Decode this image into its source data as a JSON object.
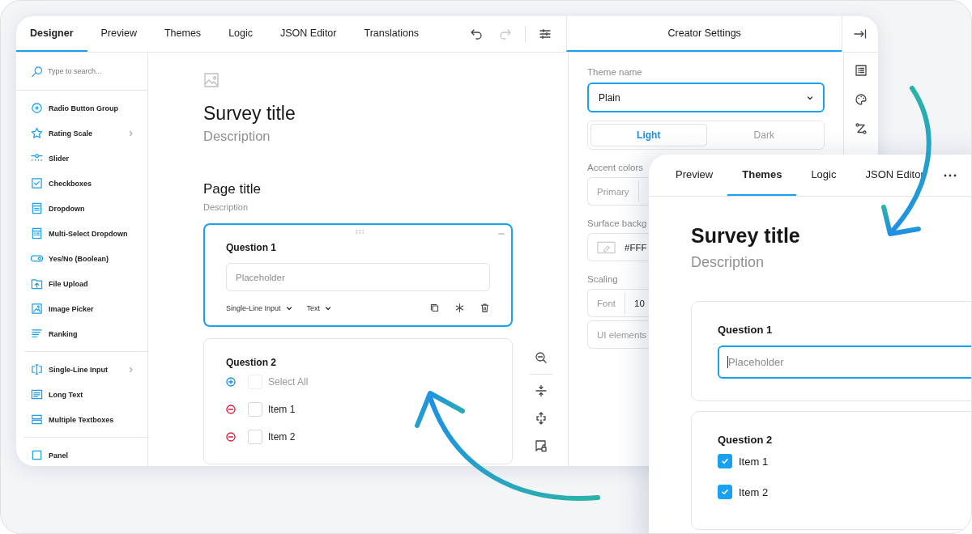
{
  "designer_window": {
    "tabs": [
      {
        "label": "Designer",
        "selected": true
      },
      {
        "label": "Preview",
        "selected": false
      },
      {
        "label": "Themes",
        "selected": false
      },
      {
        "label": "Logic",
        "selected": false
      },
      {
        "label": "JSON Editor",
        "selected": false
      },
      {
        "label": "Translations",
        "selected": false
      }
    ],
    "search": {
      "placeholder": "Type to search..."
    },
    "toolbox_groups": [
      {
        "items": [
          {
            "label": "Radio Button Group",
            "expandable": false
          },
          {
            "label": "Rating Scale",
            "expandable": true
          },
          {
            "label": "Slider",
            "expandable": false
          },
          {
            "label": "Checkboxes",
            "expandable": false
          },
          {
            "label": "Dropdown",
            "expandable": false
          },
          {
            "label": "Multi-Select Dropdown",
            "expandable": false
          },
          {
            "label": "Yes/No (Boolean)",
            "expandable": false
          },
          {
            "label": "File Upload",
            "expandable": false
          },
          {
            "label": "Image Picker",
            "expandable": false
          },
          {
            "label": "Ranking",
            "expandable": false
          }
        ]
      },
      {
        "items": [
          {
            "label": "Single-Line Input",
            "expandable": true
          },
          {
            "label": "Long Text",
            "expandable": false
          },
          {
            "label": "Multiple Textboxes",
            "expandable": false
          }
        ]
      },
      {
        "items": [
          {
            "label": "Panel",
            "expandable": false
          }
        ]
      }
    ],
    "survey": {
      "title": "Survey title",
      "description": "Description"
    },
    "page": {
      "title": "Page title",
      "description": "Description"
    },
    "questions": [
      {
        "kind": "text",
        "title": "Question 1",
        "selected": true,
        "placeholder": "Placeholder",
        "type_label": "Single-Line Input",
        "input_type_label": "Text"
      },
      {
        "kind": "checkbox",
        "title": "Question 2",
        "selected": false,
        "choices": [
          {
            "label": "Select All",
            "kind": "add"
          },
          {
            "label": "Item 1",
            "kind": "remove"
          },
          {
            "label": "Item 2",
            "kind": "remove"
          }
        ]
      }
    ],
    "settings": {
      "title": "Creator Settings",
      "theme_label": "Theme name",
      "theme_value": "Plain",
      "modes": [
        {
          "label": "Light",
          "selected": true
        },
        {
          "label": "Dark",
          "selected": false
        }
      ],
      "accent_label": "Accent colors",
      "accent_field": "Primary",
      "surface_label": "Surface backg",
      "surface_value": "#FFF",
      "scaling_label": "Scaling",
      "font_field": "Font",
      "font_value": "10",
      "ui_field": "UI elements"
    }
  },
  "themes_window": {
    "tabs": [
      {
        "label": "Preview",
        "selected": false
      },
      {
        "label": "Themes",
        "selected": true
      },
      {
        "label": "Logic",
        "selected": false
      },
      {
        "label": "JSON Editor",
        "selected": false
      }
    ],
    "survey": {
      "title": "Survey title",
      "description": "Description"
    },
    "questions": [
      {
        "kind": "text",
        "title": "Question 1",
        "placeholder": "Placeholder",
        "focused": true
      },
      {
        "kind": "checkbox",
        "title": "Question 2",
        "choices": [
          {
            "label": "Item 1",
            "checked": true
          },
          {
            "label": "Item 2",
            "checked": true
          }
        ]
      }
    ]
  }
}
